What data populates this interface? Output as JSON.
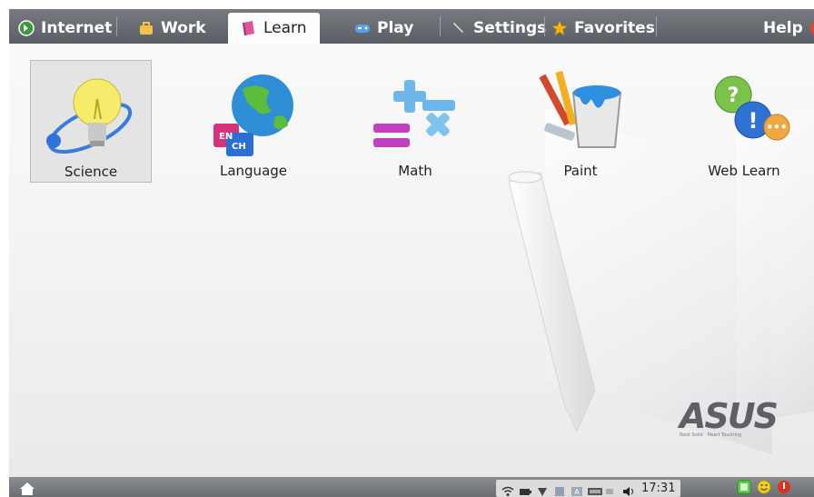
{
  "tabs": [
    {
      "label": "Internet",
      "icon": "globe-icon",
      "active": false
    },
    {
      "label": "Work",
      "icon": "briefcase-icon",
      "active": false
    },
    {
      "label": "Learn",
      "icon": "book-icon",
      "active": true
    },
    {
      "label": "Play",
      "icon": "gamepad-icon",
      "active": false
    },
    {
      "label": "Settings",
      "icon": "wrench-icon",
      "active": false
    },
    {
      "label": "Favorites",
      "icon": "star-icon",
      "active": false
    }
  ],
  "help": {
    "label": "Help",
    "icon": "help-icon"
  },
  "apps": [
    {
      "label": "Science",
      "icon": "lightbulb-icon",
      "selected": true
    },
    {
      "label": "Language",
      "icon": "globe-language-icon",
      "selected": false
    },
    {
      "label": "Math",
      "icon": "math-symbols-icon",
      "selected": false
    },
    {
      "label": "Paint",
      "icon": "paint-bucket-icon",
      "selected": false
    },
    {
      "label": "Web Learn",
      "icon": "question-bubbles-icon",
      "selected": false
    }
  ],
  "language_icon_text": {
    "en": "EN",
    "ch": "CH"
  },
  "brand": {
    "logo": "ASUS",
    "tagline": "Rock Solid · Heart Touching"
  },
  "taskbar": {
    "home_icon": "home-icon",
    "clock": "17:31",
    "tray_icons": [
      "wifi-icon",
      "battery-icon",
      "signal-icon",
      "disk-icon",
      "keyboard-layout-icon",
      "network-card-icon",
      "dock-icon",
      "volume-icon"
    ],
    "right_icons": [
      "green-square-icon",
      "smiley-icon",
      "power-icon"
    ]
  },
  "colors": {
    "topbar": "#5b5f65",
    "active_tab": "#fdfdfd",
    "taskbar": "#6b6e72"
  }
}
